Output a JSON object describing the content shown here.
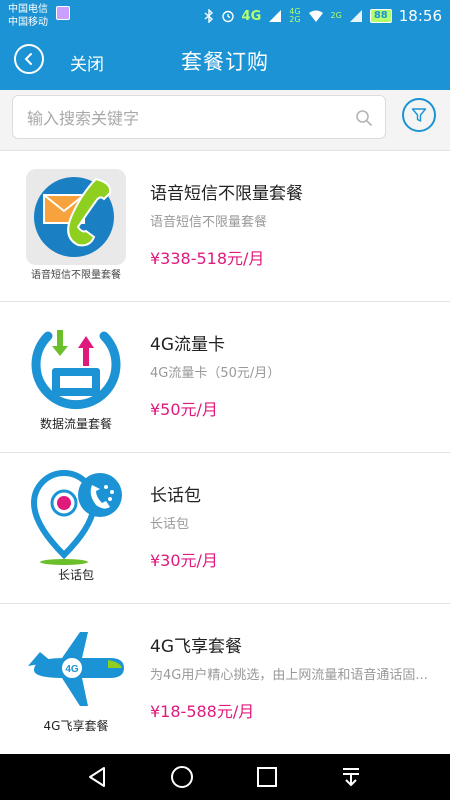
{
  "status_bar": {
    "carrier_1": "中国电信",
    "carrier_2": "中国移动",
    "network": "4G",
    "network_small_1": "4G",
    "network_small_2": "2G",
    "network_small_3": "2G",
    "battery": "88",
    "time": "18:56"
  },
  "title_bar": {
    "close_label": "关闭",
    "title": "套餐订购"
  },
  "search": {
    "placeholder": "输入搜索关键字"
  },
  "packages": [
    {
      "thumb_caption": "语音短信不限量套餐",
      "title": "语音短信不限量套餐",
      "subtitle": "语音短信不限量套餐",
      "price": "¥338-518元/月"
    },
    {
      "thumb_caption": "数据流量套餐",
      "title": "4G流量卡",
      "subtitle": "4G流量卡（50元/月）",
      "price": "¥50元/月"
    },
    {
      "thumb_caption": "长话包",
      "title": "长话包",
      "subtitle": "长话包",
      "price": "¥30元/月"
    },
    {
      "thumb_caption": "4G飞享套餐",
      "thumb_badge": "4G",
      "title": "4G飞享套餐",
      "subtitle": "为4G用户精心挑选，由上网流量和语音通话固...",
      "price": "¥18-588元/月"
    }
  ],
  "colors": {
    "accent": "#1b93d4",
    "price": "#e0197d",
    "phone_green": "#8ecf1f"
  }
}
